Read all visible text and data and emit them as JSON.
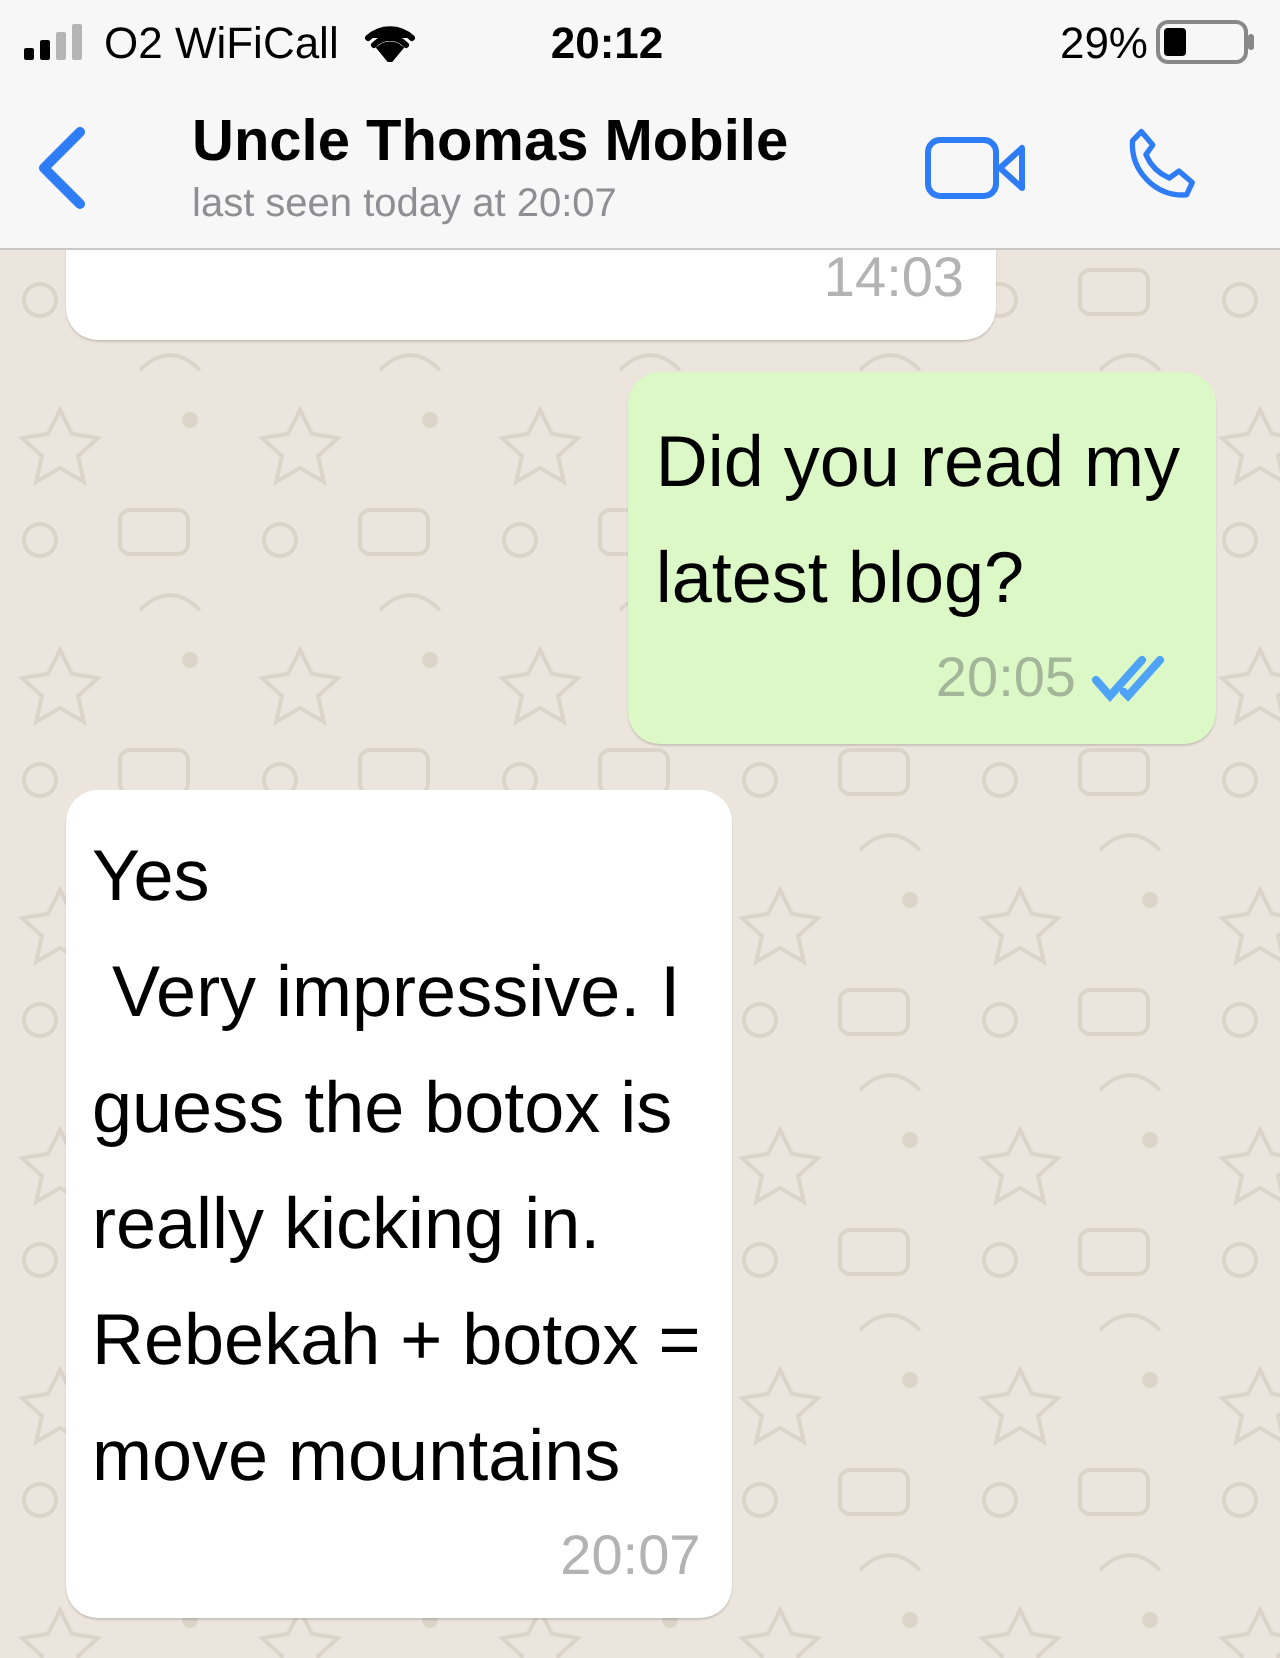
{
  "status_bar": {
    "carrier": "O2 WiFiCall",
    "time": "20:12",
    "battery": "29%"
  },
  "header": {
    "title": "Uncle Thomas Mobile",
    "subtitle": "last seen today at 20:07"
  },
  "messages": [
    {
      "kind": "incoming",
      "time": "14:03"
    },
    {
      "kind": "outgoing",
      "text": "Did you read my\nlatest blog?",
      "time": "20:05",
      "read": true
    },
    {
      "kind": "incoming",
      "text": "Yes\n Very impressive. I\nguess the botox is\nreally kicking in.\nRebekah + botox =\nmove mountains",
      "time": "20:07"
    }
  ]
}
